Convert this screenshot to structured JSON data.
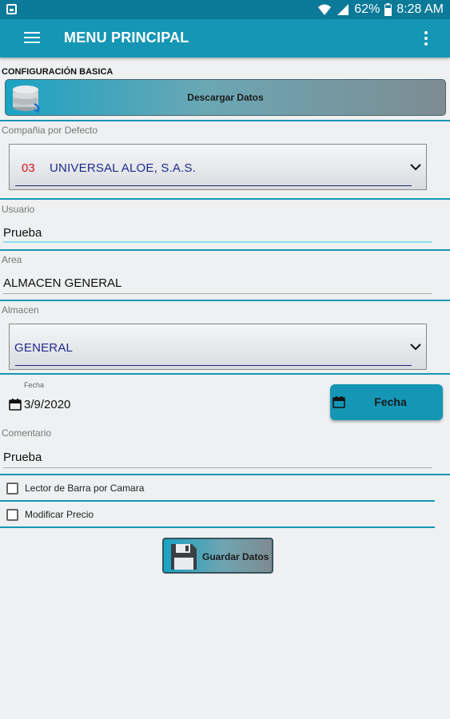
{
  "statusbar": {
    "battery": "62%",
    "time": "8:28 AM"
  },
  "appbar": {
    "title": "MENU PRINCIPAL"
  },
  "section": {
    "title": "CONFIGURACIÓN BASICA"
  },
  "download": {
    "label": "Descargar Datos"
  },
  "company": {
    "label": "Compañia por Defecto",
    "code": "03",
    "value": "UNIVERSAL ALOE, S.A.S."
  },
  "user": {
    "label": "Usuario",
    "value": "Prueba"
  },
  "area": {
    "label": "Area",
    "value": "ALMACEN GENERAL"
  },
  "warehouse": {
    "label": "Almacen",
    "value": "GENERAL"
  },
  "date": {
    "caption": "Fecha",
    "value": "3/9/2020",
    "button_label": "Fecha"
  },
  "comment": {
    "label": "Comentario",
    "value": "Prueba"
  },
  "options": [
    {
      "label": "Lector de Barra por Camara",
      "checked": false
    },
    {
      "label": "Modificar Precio",
      "checked": false
    }
  ],
  "save": {
    "label": "Guardar Datos"
  },
  "colors": {
    "primary": "#1596b5",
    "status_bar": "#0b7a98",
    "code_red": "#d8141b",
    "value_blue": "#1f2b8c"
  }
}
